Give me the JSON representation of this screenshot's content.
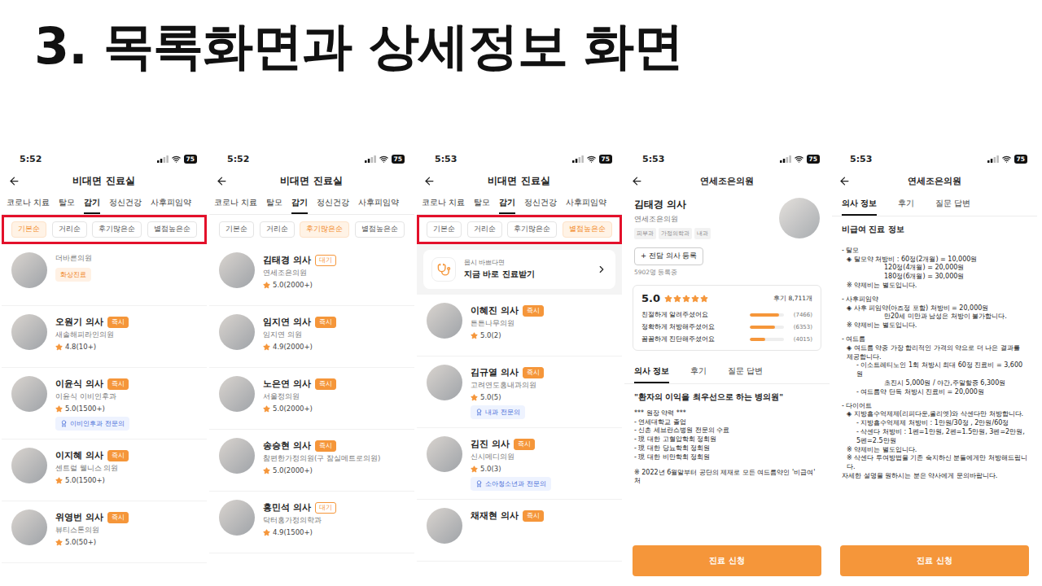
{
  "slide_title": "3. 목록화면과 상세정보 화면",
  "screens": [
    {
      "kind": "list",
      "time": "5:52",
      "battery": "75",
      "title": "비대면 진료실",
      "categories": [
        {
          "label": "코로나 치료",
          "selected": false
        },
        {
          "label": "탈모",
          "selected": false
        },
        {
          "label": "감기",
          "selected": true
        },
        {
          "label": "정신건강",
          "selected": false
        },
        {
          "label": "사후피임약",
          "selected": false
        }
      ],
      "sort_highlighted": true,
      "sorts": [
        {
          "label": "기본순",
          "selected": true
        },
        {
          "label": "거리순",
          "selected": false
        },
        {
          "label": "후기많은순",
          "selected": false
        },
        {
          "label": "별점높은순",
          "selected": false
        }
      ],
      "doctors": [
        {
          "hospital": "더바른의원",
          "tag": "화상진료"
        },
        {
          "name": "오원기 의사",
          "status": "즉시",
          "status_kind": "now",
          "hospital": "새솔해피라인의원",
          "rating": "4.8(10+)"
        },
        {
          "name": "이윤식 의사",
          "status": "즉시",
          "status_kind": "now",
          "hospital": "이윤식 이비인후과",
          "rating": "5.0(1500+)",
          "specialty": "이비인후과 전문의"
        },
        {
          "name": "이지혜 의사",
          "status": "즉시",
          "status_kind": "now",
          "hospital": "센트럴 웰니스 의원",
          "rating": "5.0(1500+)"
        },
        {
          "name": "위영번 의사",
          "status": "즉시",
          "status_kind": "now",
          "hospital": "뷰티스톤의원",
          "rating": "5.0(50+)"
        }
      ]
    },
    {
      "kind": "list",
      "time": "5:52",
      "battery": "75",
      "title": "비대면 진료실",
      "categories": [
        {
          "label": "코로나 치료",
          "selected": false
        },
        {
          "label": "탈모",
          "selected": false
        },
        {
          "label": "감기",
          "selected": true
        },
        {
          "label": "정신건강",
          "selected": false
        },
        {
          "label": "사후피임약",
          "selected": false
        }
      ],
      "sort_highlighted": false,
      "sorts": [
        {
          "label": "기본순",
          "selected": false
        },
        {
          "label": "거리순",
          "selected": false
        },
        {
          "label": "후기많은순",
          "selected": true
        },
        {
          "label": "별점높은순",
          "selected": false
        }
      ],
      "doctors": [
        {
          "name": "김태경 의사",
          "status": "대기",
          "status_kind": "wait",
          "hospital": "연세조은의원",
          "rating": "5.0(2000+)"
        },
        {
          "name": "임지연 의사",
          "status": "즉시",
          "status_kind": "now",
          "hospital": "임지연 의원",
          "rating": "4.9(2000+)"
        },
        {
          "name": "노은연 의사",
          "status": "즉시",
          "status_kind": "now",
          "hospital": "서울정의원",
          "rating": "5.0(2000+)"
        },
        {
          "name": "송승현 의사",
          "status": "즉시",
          "status_kind": "now",
          "hospital": "참편한가정의원(구 잠실메트로의원)",
          "rating": "5.0(2000+)"
        },
        {
          "name": "홍민석 의사",
          "status": "대기",
          "status_kind": "wait",
          "hospital": "닥터홍가정의학과",
          "rating": "4.9(1500+)"
        }
      ]
    },
    {
      "kind": "list",
      "time": "5:53",
      "battery": "75",
      "title": "비대면 진료실",
      "categories": [
        {
          "label": "코로나 치료",
          "selected": false
        },
        {
          "label": "탈모",
          "selected": false
        },
        {
          "label": "감기",
          "selected": true
        },
        {
          "label": "정신건강",
          "selected": false
        },
        {
          "label": "사후피임약",
          "selected": false
        }
      ],
      "sort_highlighted": true,
      "sorts": [
        {
          "label": "기본순",
          "selected": false
        },
        {
          "label": "거리순",
          "selected": false
        },
        {
          "label": "후기많은순",
          "selected": false
        },
        {
          "label": "별점높은순",
          "selected": true
        }
      ],
      "banner": {
        "caption": "몹시 바쁘다면",
        "title": "지금 바로 진료받기"
      },
      "doctors": [
        {
          "name": "이혜진 의사",
          "status": "즉시",
          "status_kind": "now",
          "hospital": "튼튼나무의원",
          "rating": "5.0(2)"
        },
        {
          "name": "김규열 의사",
          "status": "즉시",
          "status_kind": "now",
          "hospital": "고려연도홍내과의원",
          "rating": "5.0(5)",
          "specialty": "내과 전문의"
        },
        {
          "name": "김진 의사",
          "status": "즉시",
          "status_kind": "now",
          "hospital": "신시메디의원",
          "rating": "5.0(3)",
          "specialty": "소아청소년과 전문의"
        },
        {
          "name": "채재현 의사",
          "status": "즉시",
          "status_kind": "now"
        }
      ]
    },
    {
      "kind": "profile",
      "time": "5:53",
      "battery": "75",
      "title": "연세조은의원",
      "doctor": {
        "name": "김태경 의사",
        "hospital": "연세조은의원",
        "departments": [
          "피부과",
          "가정의학과",
          "내과"
        ]
      },
      "register_button": "+ 전담 의사 등록",
      "registered": "5902명 등록중",
      "rating": {
        "score": "5.0",
        "stars": 5,
        "reviews": "후기 8,711개",
        "bars": [
          {
            "label": "친절하게 알려주셨어요",
            "count": "(7466)",
            "level": 0.857
          },
          {
            "label": "정확하게 처방해주셨어요",
            "count": "(6353)",
            "level": 0.729
          },
          {
            "label": "꼼꼼하게 진단해주셨어요",
            "count": "(4015)",
            "level": 0.461
          }
        ]
      },
      "tabs": [
        {
          "label": "의사 정보",
          "selected": true
        },
        {
          "label": "후기",
          "selected": false
        },
        {
          "label": "질문 답변",
          "selected": false
        }
      ],
      "lines": [
        {
          "kind": "quote",
          "text": "\"환자의 이익을 최우선으로 하는 병의원\""
        },
        {
          "kind": "plain",
          "text": "*** 원장 약력 ***"
        },
        {
          "kind": "plain",
          "text": "- 연세대학교 졸업"
        },
        {
          "kind": "plain",
          "text": "- 신촌 세브란스병원 전문의 수료"
        },
        {
          "kind": "plain",
          "text": "- 現 대한 고혈압학회 정회원"
        },
        {
          "kind": "plain",
          "text": "- 現 대한 당뇨학회 정회원"
        },
        {
          "kind": "plain",
          "text": "- 現 대한 비만학회 정회원"
        },
        {
          "kind": "gap",
          "text": "※ 2022년 6월말부터 공단의 제재로 모든 여드름약인 '비급여' 처"
        }
      ],
      "action": "진료 신청"
    },
    {
      "kind": "info",
      "time": "5:53",
      "battery": "75",
      "title": "연세조은의원",
      "tabs": [
        {
          "label": "의사 정보",
          "selected": true
        },
        {
          "label": "후기",
          "selected": false
        },
        {
          "label": "질문 답변",
          "selected": false
        }
      ],
      "lines": [
        {
          "kind": "heading",
          "text": "비급여 진료 정보"
        },
        {
          "kind": "section",
          "text": "- 탈모"
        },
        {
          "kind": "item",
          "text": "◈ 탈모약 처방비 :  60정(2개월) = 10,000원"
        },
        {
          "kind": "cont",
          "text": "120정(4개월) = 20,000원"
        },
        {
          "kind": "cont",
          "text": "180정(6개월) = 30,000원"
        },
        {
          "kind": "note",
          "text": "※ 약제비는 별도입니다."
        },
        {
          "kind": "section",
          "text": "- 사후피임약"
        },
        {
          "kind": "item",
          "text": "◈ 사후 피임약(아즈정 포함) 처방비 = 20,000원"
        },
        {
          "kind": "cont",
          "text": "만20세 미만과 남성은 처방이 불가합니다."
        },
        {
          "kind": "note",
          "text": "※ 약제비는 별도입니다."
        },
        {
          "kind": "section",
          "text": "- 여드름"
        },
        {
          "kind": "item",
          "text": "◈ 여드름 약중 가장 합리적인 가격의 약으로 더 나은 결과를 제공합니다."
        },
        {
          "kind": "sub",
          "text": "- 이소트레티노인 1회 처방시 최대 60정 진료비 = 3,600원"
        },
        {
          "kind": "cont",
          "text": "초진시 5,000원 / 야간,주말할증 6,300원"
        },
        {
          "kind": "sub",
          "text": "- 여드름약 단독 처방시 진료비 = 20,000원"
        },
        {
          "kind": "section",
          "text": "- 다이어트"
        },
        {
          "kind": "item",
          "text": "◈ 지방흡수억제제(리피다운,올리엣)와 삭센다만 처방합니다."
        },
        {
          "kind": "sub",
          "text": "- 지방흡수억제제 처방비 : 1만원/30정 , 2만원/60정"
        },
        {
          "kind": "sub",
          "text": "- 삭센다 처방비 : 1펜=1만원, 2펜=1.5만원, 3펜=2만원, 5펜=2.5만원"
        },
        {
          "kind": "note",
          "text": "※ 약제비는 별도입니다."
        },
        {
          "kind": "note",
          "text": "※ 삭센다 투여방법을 기존 숙지하신 분들에게만 처방해드립니다."
        },
        {
          "kind": "plain",
          "text": "자세한 설명을 원하시는 분은 약사에게 문의바랍니다."
        }
      ],
      "action": "진료 신청"
    }
  ]
}
